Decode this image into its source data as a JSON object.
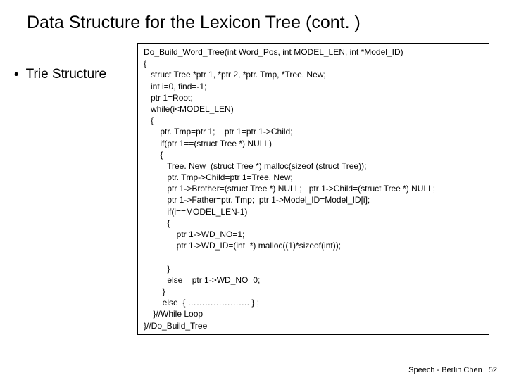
{
  "title": "Data Structure for the Lexicon Tree (cont. )",
  "bullet": "Trie Structure",
  "code": "Do_Build_Word_Tree(int Word_Pos, int MODEL_LEN, int *Model_ID)\n{\n   struct Tree *ptr 1, *ptr 2, *ptr. Tmp, *Tree. New;\n   int i=0, find=-1;\n   ptr 1=Root;\n   while(i<MODEL_LEN)\n   {\n       ptr. Tmp=ptr 1;    ptr 1=ptr 1->Child;\n       if(ptr 1==(struct Tree *) NULL)\n       {\n          Tree. New=(struct Tree *) malloc(sizeof (struct Tree));\n          ptr. Tmp->Child=ptr 1=Tree. New;\n          ptr 1->Brother=(struct Tree *) NULL;   ptr 1->Child=(struct Tree *) NULL;\n          ptr 1->Father=ptr. Tmp;  ptr 1->Model_ID=Model_ID[i];\n          if(i==MODEL_LEN-1)\n          {\n              ptr 1->WD_NO=1;\n              ptr 1->WD_ID=(int  *) malloc((1)*sizeof(int));\n\n          }\n          else    ptr 1->WD_NO=0;\n        }\n        else  { …………………. } ;\n    }//While Loop\n}//Do_Build_Tree",
  "footer_text": "Speech - Berlin Chen",
  "footer_page": "52"
}
